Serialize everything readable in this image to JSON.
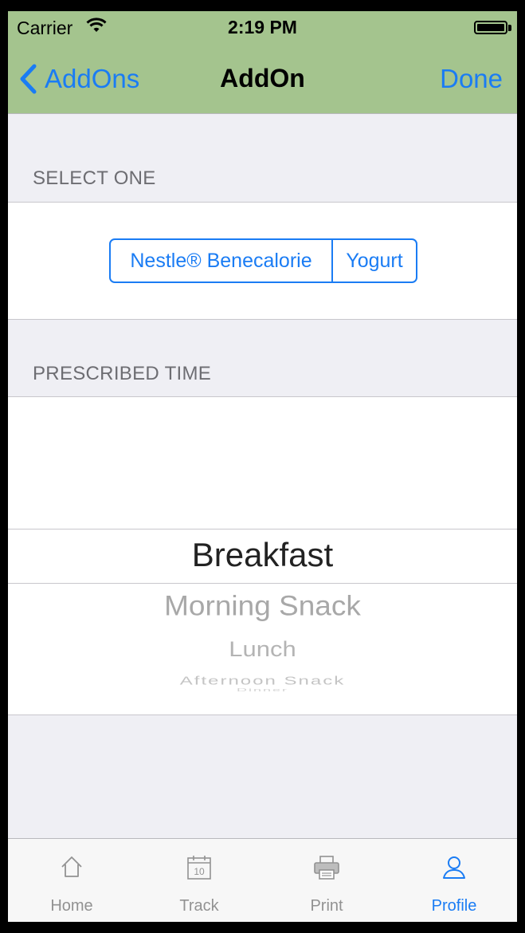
{
  "status": {
    "carrier": "Carrier",
    "time": "2:19 PM"
  },
  "nav": {
    "back_label": "AddOns",
    "title": "AddOn",
    "done_label": "Done"
  },
  "select_section": {
    "header": "SELECT ONE",
    "options": [
      "Nestle® Benecalorie",
      "Yogurt"
    ]
  },
  "time_section": {
    "header": "PRESCRIBED TIME"
  },
  "picker": {
    "items": [
      "Breakfast",
      "Morning Snack",
      "Lunch",
      "Afternoon Snack",
      "Dinner"
    ],
    "selected": "Breakfast"
  },
  "tabbar": {
    "tabs": [
      {
        "label": "Home",
        "icon": "home-icon"
      },
      {
        "label": "Track",
        "icon": "calendar-icon",
        "badge": "10"
      },
      {
        "label": "Print",
        "icon": "printer-icon"
      },
      {
        "label": "Profile",
        "icon": "person-icon"
      }
    ],
    "active": "Profile"
  },
  "colors": {
    "navbar": "#a4c48e",
    "accent": "#1a7cf4",
    "background": "#efeff4"
  }
}
